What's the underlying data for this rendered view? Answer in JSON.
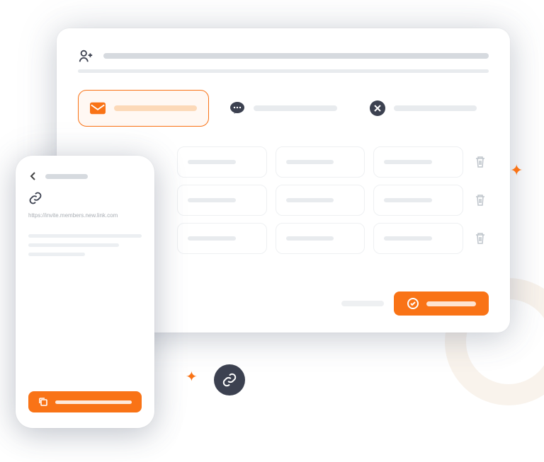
{
  "desktop": {
    "header_icon": "user-plus",
    "tabs": [
      {
        "icon": "mail",
        "active": true
      },
      {
        "icon": "chat",
        "active": false
      },
      {
        "icon": "close-circle",
        "active": false
      }
    ],
    "grid_rows": 3,
    "grid_cols": 3,
    "confirm_icon": "check-circle"
  },
  "phone": {
    "back_icon": "arrow-left",
    "link_icon": "link",
    "url_text": "https://invite.members.new.link.com",
    "copy_button_icon": "copy"
  },
  "decorations": {
    "badge_icon": "link",
    "accent_color": "#f97316",
    "badge_color": "#3c4150"
  }
}
